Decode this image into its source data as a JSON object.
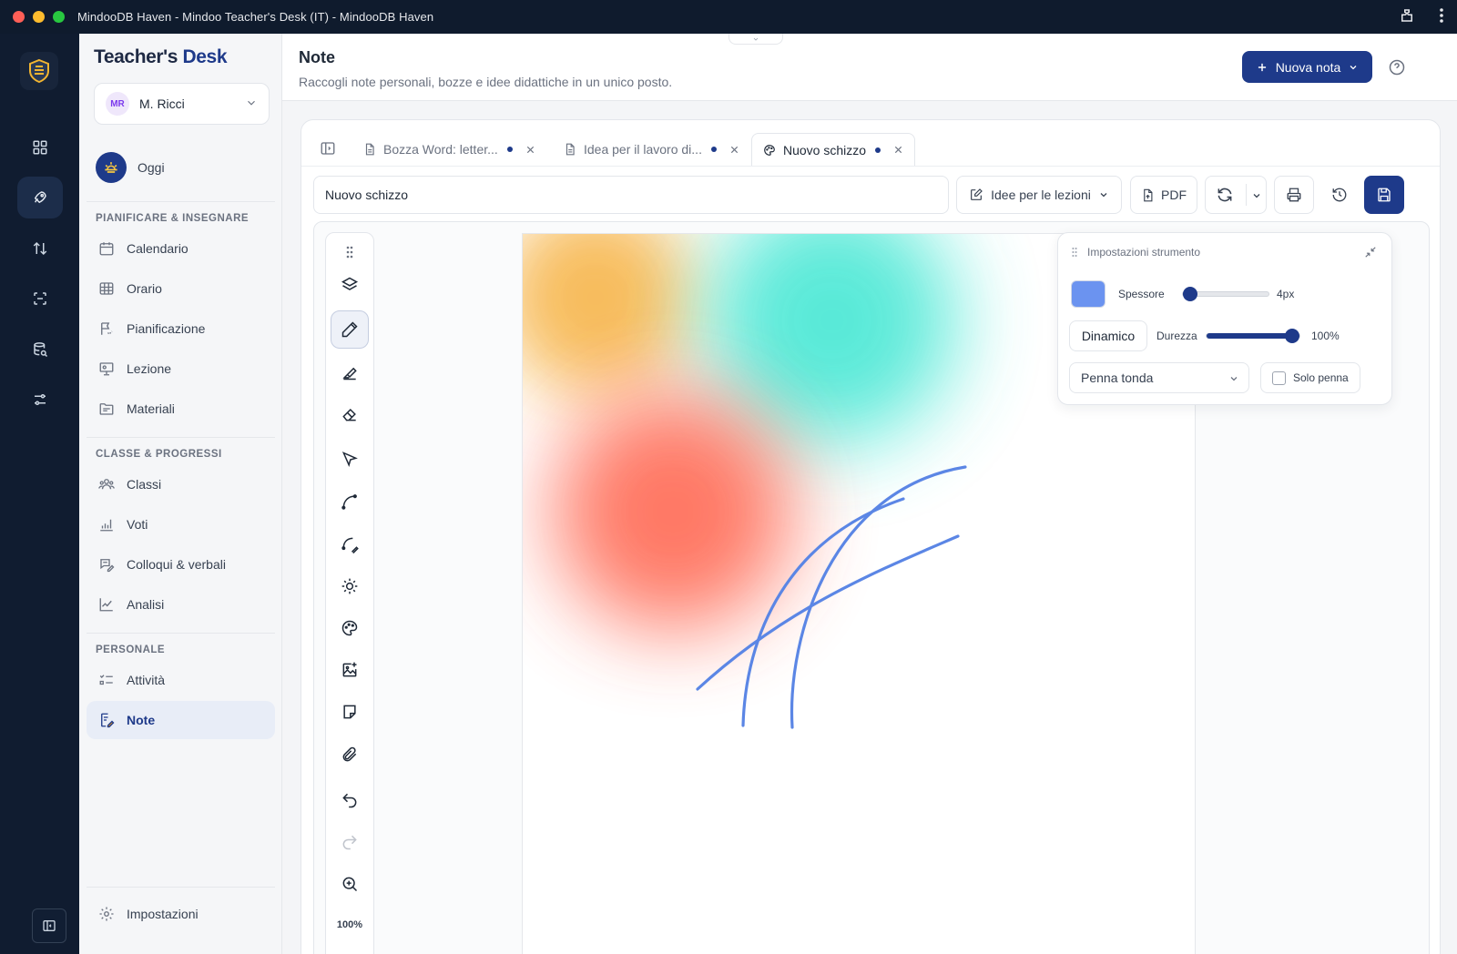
{
  "window": {
    "title": "MindooDB Haven - Mindoo Teacher's Desk (IT) - MindooDB Haven"
  },
  "colors": {
    "primary": "#1e3a8a",
    "pen": "#6b93f0"
  },
  "rail": {
    "items": [
      {
        "icon": "grid-icon",
        "active": false
      },
      {
        "icon": "rocket-icon",
        "active": true
      },
      {
        "icon": "sync-arrows-icon",
        "active": false
      },
      {
        "icon": "scan-icon",
        "active": false
      },
      {
        "icon": "database-icon",
        "active": false
      },
      {
        "icon": "sliders-icon",
        "active": false
      }
    ]
  },
  "sidebar": {
    "brand_part1": "Teacher's",
    "brand_part2": "Desk",
    "user": {
      "initials": "MR",
      "name": "M. Ricci"
    },
    "today_label": "Oggi",
    "sections": [
      {
        "title": "PIANIFICARE & INSEGNARE",
        "items": [
          "Calendario",
          "Orario",
          "Pianificazione",
          "Lezione",
          "Materiali"
        ]
      },
      {
        "title": "CLASSE & PROGRESSI",
        "items": [
          "Classi",
          "Voti",
          "Colloqui & verbali",
          "Analisi"
        ]
      },
      {
        "title": "PERSONALE",
        "items": [
          "Attività",
          "Note"
        ]
      }
    ],
    "settings_label": "Impostazioni"
  },
  "header": {
    "title": "Note",
    "subtitle": "Raccogli note personali, bozze e idee didattiche in un unico posto.",
    "new_button": "Nuova nota"
  },
  "tabs": [
    {
      "label": "Bozza Word: letter...",
      "icon": "document-icon",
      "active": false
    },
    {
      "label": "Idea per il lavoro di...",
      "icon": "document-icon",
      "active": false
    },
    {
      "label": "Nuovo schizzo",
      "icon": "palette-icon",
      "active": true
    }
  ],
  "editor": {
    "title_value": "Nuovo schizzo",
    "category": "Idee per le lezioni",
    "pdf_label": "PDF",
    "zoom": "100%"
  },
  "tool_settings": {
    "title": "Impostazioni strumento",
    "thickness_label": "Spessore",
    "thickness_value": "4px",
    "thickness_fraction": 0.0,
    "dynamic_label": "Dinamico",
    "hardness_label": "Durezza",
    "hardness_value": "100%",
    "hardness_fraction": 1.0,
    "brush": "Penna tonda",
    "pen_only_label": "Solo penna",
    "pen_only_checked": false
  }
}
